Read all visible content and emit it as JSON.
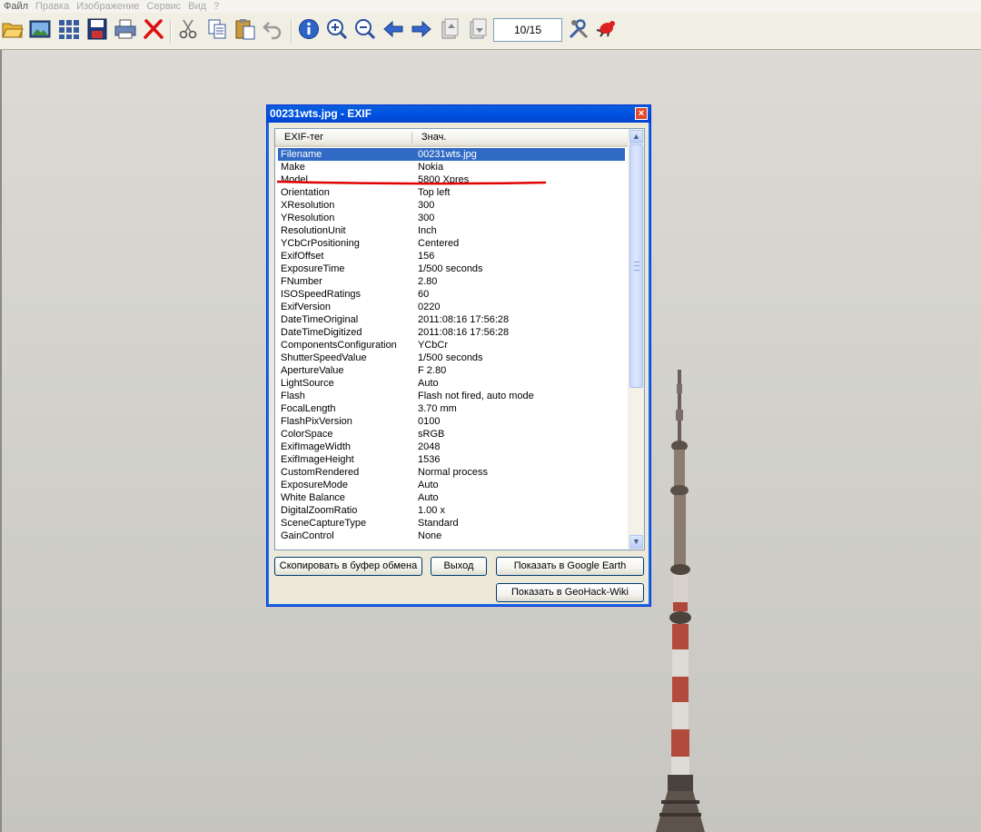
{
  "menu": [
    "Файл",
    "Правка",
    "Изображение",
    "Сервис",
    "Вид",
    "?"
  ],
  "toolbar": {
    "icons": [
      "open-folder-icon",
      "image-icon",
      "thumbnails-icon",
      "save-icon",
      "print-icon",
      "delete-icon",
      "cut-icon",
      "copy-icon",
      "paste-icon",
      "undo-icon",
      "info-icon",
      "zoom-in-icon",
      "zoom-out-icon",
      "previous-icon",
      "next-icon",
      "first-page-icon",
      "last-page-icon",
      "settings-icon",
      "exit-icon"
    ],
    "counter": "10/15"
  },
  "dialog": {
    "title": "00231wts.jpg - EXIF",
    "close": "×",
    "columns": {
      "tag": "EXIF-тег",
      "value": "Знач."
    },
    "rows": [
      {
        "tag": "Filename",
        "value": "00231wts.jpg"
      },
      {
        "tag": "Make",
        "value": "Nokia"
      },
      {
        "tag": "Model",
        "value": "5800 Xpres"
      },
      {
        "tag": "Orientation",
        "value": "Top left"
      },
      {
        "tag": "XResolution",
        "value": "300"
      },
      {
        "tag": "YResolution",
        "value": "300"
      },
      {
        "tag": "ResolutionUnit",
        "value": "Inch"
      },
      {
        "tag": "YCbCrPositioning",
        "value": "Centered"
      },
      {
        "tag": "ExifOffset",
        "value": "156"
      },
      {
        "tag": "ExposureTime",
        "value": "1/500 seconds"
      },
      {
        "tag": "FNumber",
        "value": "2.80"
      },
      {
        "tag": "ISOSpeedRatings",
        "value": "60"
      },
      {
        "tag": "ExifVersion",
        "value": "0220"
      },
      {
        "tag": "DateTimeOriginal",
        "value": "2011:08:16 17:56:28"
      },
      {
        "tag": "DateTimeDigitized",
        "value": "2011:08:16 17:56:28"
      },
      {
        "tag": "ComponentsConfiguration",
        "value": "YCbCr"
      },
      {
        "tag": "ShutterSpeedValue",
        "value": "1/500 seconds"
      },
      {
        "tag": "ApertureValue",
        "value": "F 2.80"
      },
      {
        "tag": "LightSource",
        "value": "Auto"
      },
      {
        "tag": "Flash",
        "value": "Flash not fired, auto mode"
      },
      {
        "tag": "FocalLength",
        "value": "3.70 mm"
      },
      {
        "tag": "FlashPixVersion",
        "value": "0100"
      },
      {
        "tag": "ColorSpace",
        "value": "sRGB"
      },
      {
        "tag": "ExifImageWidth",
        "value": "2048"
      },
      {
        "tag": "ExifImageHeight",
        "value": "1536"
      },
      {
        "tag": "CustomRendered",
        "value": "Normal process"
      },
      {
        "tag": "ExposureMode",
        "value": "Auto"
      },
      {
        "tag": "White Balance",
        "value": "Auto"
      },
      {
        "tag": "DigitalZoomRatio",
        "value": "1.00 x"
      },
      {
        "tag": "SceneCaptureType",
        "value": "Standard"
      },
      {
        "tag": "GainControl",
        "value": "None"
      }
    ],
    "selected_row": 0,
    "buttons": {
      "copy": "Скопировать в буфер обмена",
      "exit": "Выход",
      "google_earth": "Показать в Google Earth",
      "geohack": "Показать в GeoHack-Wiki"
    }
  },
  "colors": {
    "selection": "#316ac5",
    "titlebar": "#0055e5",
    "annotation_line": "#e00000"
  }
}
